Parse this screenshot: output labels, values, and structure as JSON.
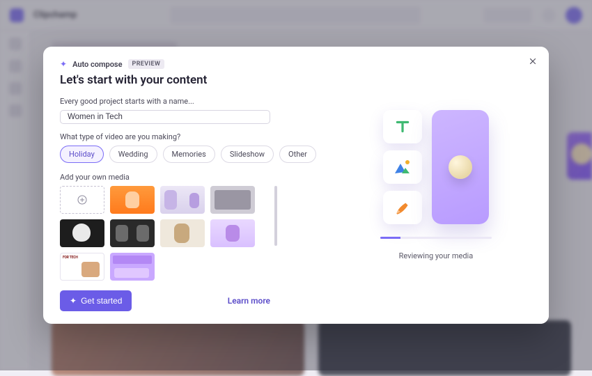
{
  "bg": {
    "app_name": "Clipchamp"
  },
  "modal": {
    "tag": {
      "label": "Auto compose",
      "badge": "PREVIEW"
    },
    "heading": "Let's start with your content",
    "name_label": "Every good project starts with a name...",
    "name_value": "Women in Tech",
    "type_label": "What type of video are you making?",
    "types": [
      "Holiday",
      "Wedding",
      "Memories",
      "Slideshow",
      "Other"
    ],
    "selected_type": 0,
    "media_label": "Add your own media",
    "get_started": "Get started",
    "learn_more": "Learn more",
    "status": "Reviewing your media"
  }
}
